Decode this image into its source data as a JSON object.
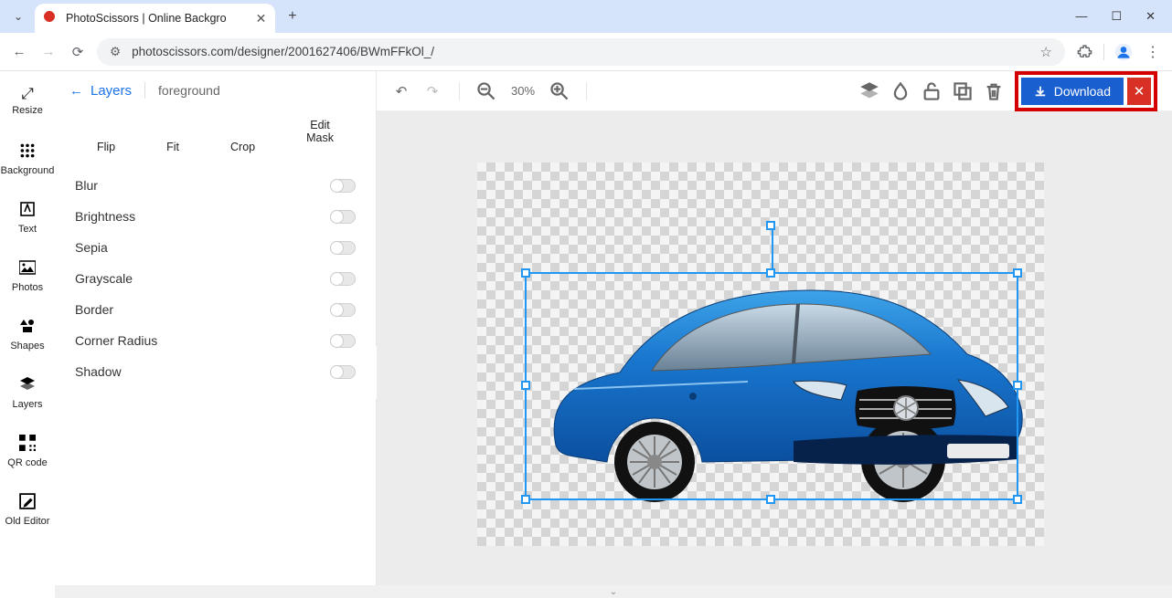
{
  "browser": {
    "tab_title": "PhotoScissors | Online Backgro",
    "url": "photoscissors.com/designer/2001627406/BWmFFkOl_/"
  },
  "left_rail": {
    "items": [
      {
        "label": "Resize",
        "icon": "resize-icon"
      },
      {
        "label": "Background",
        "icon": "grid-icon"
      },
      {
        "label": "Text",
        "icon": "text-icon"
      },
      {
        "label": "Photos",
        "icon": "photo-icon"
      },
      {
        "label": "Shapes",
        "icon": "shapes-icon"
      },
      {
        "label": "Layers",
        "icon": "layers-icon"
      },
      {
        "label": "QR code",
        "icon": "qrcode-icon"
      },
      {
        "label": "Old Editor",
        "icon": "edit-icon"
      }
    ]
  },
  "panel": {
    "back_label": "Layers",
    "layer_name": "foreground",
    "tools": [
      {
        "label": "Flip"
      },
      {
        "label": "Fit"
      },
      {
        "label": "Crop"
      },
      {
        "label": "Edit\nMask"
      }
    ],
    "adjustments": [
      {
        "label": "Blur",
        "enabled": false
      },
      {
        "label": "Brightness",
        "enabled": false
      },
      {
        "label": "Sepia",
        "enabled": false
      },
      {
        "label": "Grayscale",
        "enabled": false
      },
      {
        "label": "Border",
        "enabled": false
      },
      {
        "label": "Corner Radius",
        "enabled": false
      },
      {
        "label": "Shadow",
        "enabled": false
      }
    ]
  },
  "toolbar": {
    "zoom_value": "30%",
    "download_label": "Download"
  },
  "canvas": {
    "subject": "blue-car"
  }
}
